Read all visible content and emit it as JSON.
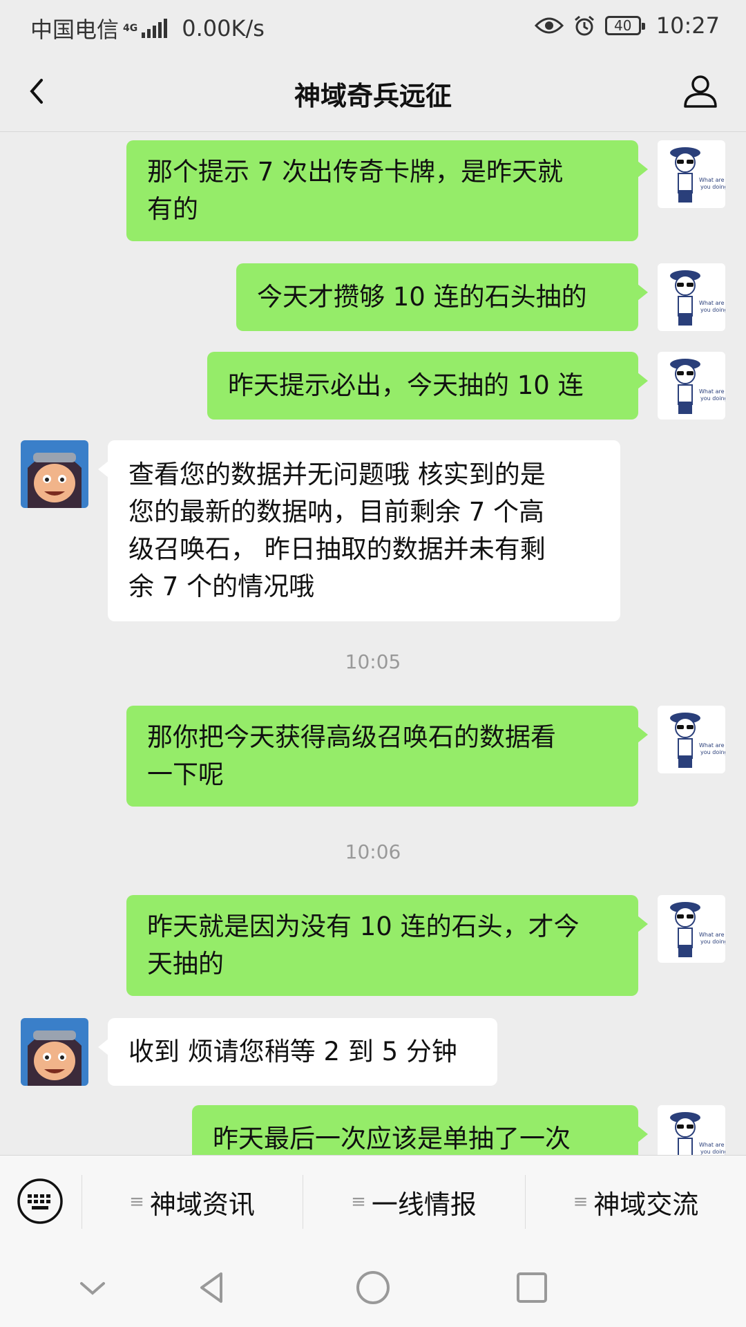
{
  "status_bar": {
    "carrier": "中国电信",
    "network": "4G",
    "speed": "0.00K/s",
    "battery": "40",
    "time": "10:27"
  },
  "header": {
    "title": "神域奇兵远征",
    "back_icon": "chevron-left-icon",
    "profile_icon": "person-icon"
  },
  "messages": [
    {
      "side": "out",
      "lines": [
        "那个提示 7 次出传奇卡牌，是昨天就",
        "有的"
      ]
    },
    {
      "side": "out",
      "lines": [
        "今天才攒够 10 连的石头抽的"
      ]
    },
    {
      "side": "out",
      "lines": [
        "昨天提示必出，今天抽的 10 连"
      ]
    },
    {
      "side": "in",
      "lines": [
        "查看您的数据并无问题哦 核实到的是",
        "您的最新的数据呐，目前剩余 7 个高",
        "级召唤石， 昨日抽取的数据并未有剩",
        "余 7 个的情况哦"
      ]
    },
    {
      "side": "out",
      "lines": [
        "那你把今天获得高级召唤石的数据看",
        "一下呢"
      ]
    },
    {
      "side": "out",
      "lines": [
        "昨天就是因为没有 10 连的石头，才今",
        "天抽的"
      ]
    },
    {
      "side": "in",
      "lines": [
        "收到 烦请您稍等 2 到 5 分钟"
      ]
    },
    {
      "side": "out",
      "lines": [
        "昨天最后一次应该是单抽了一次"
      ]
    }
  ],
  "timestamps": [
    "10:05",
    "10:06"
  ],
  "bottom_menu": {
    "keyboard_icon": "keyboard-icon",
    "items": [
      "神域资讯",
      "一线情报",
      "神域交流"
    ]
  },
  "nav": [
    "back-icon",
    "home-icon",
    "recents-icon",
    "collapse-icon"
  ],
  "colors": {
    "outgoing_bubble": "#95ec69",
    "incoming_bubble": "#ffffff",
    "background": "#ededed"
  }
}
